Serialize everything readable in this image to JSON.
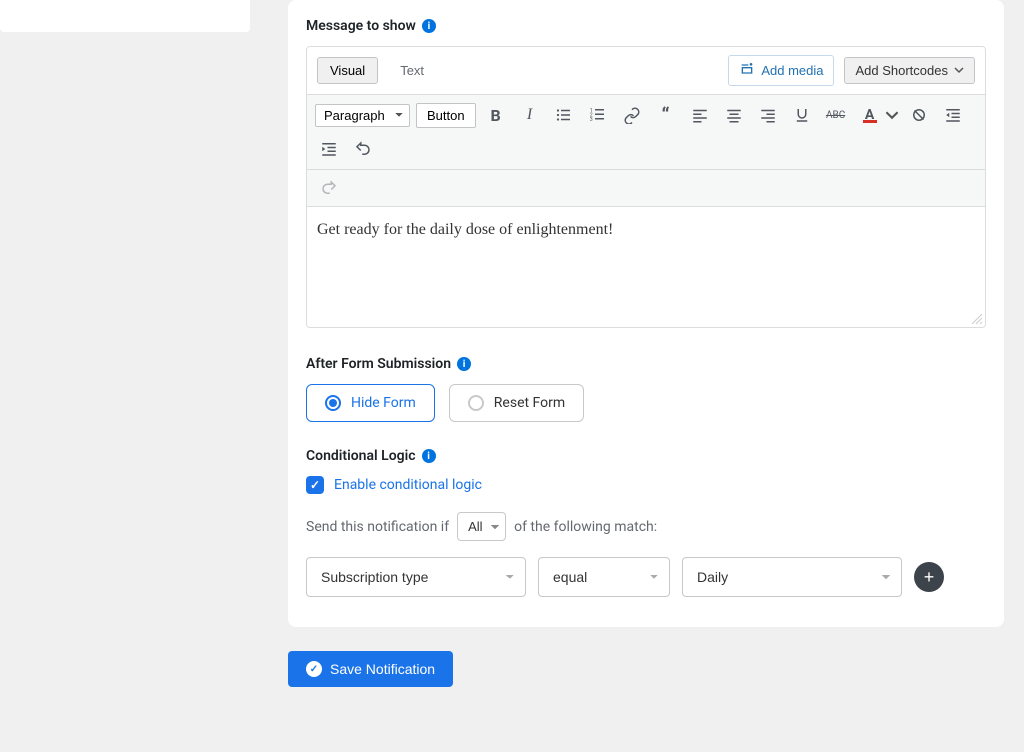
{
  "sections": {
    "message_label": "Message to show",
    "after_label": "After Form Submission",
    "logic_label": "Conditional Logic"
  },
  "editor": {
    "tabs": {
      "visual": "Visual",
      "text": "Text"
    },
    "add_media": "Add media",
    "add_shortcodes": "Add Shortcodes",
    "format": "Paragraph",
    "button_tool": "Button",
    "content": "Get ready for the daily dose of enlightenment!"
  },
  "after_submission": {
    "hide": "Hide Form",
    "reset": "Reset Form"
  },
  "logic": {
    "enable_label": "Enable conditional logic",
    "prefix": "Send this notification if",
    "match_mode": "All",
    "suffix": "of the following match:",
    "field": "Subscription type",
    "operator": "equal",
    "value": "Daily"
  },
  "save_label": "Save Notification"
}
